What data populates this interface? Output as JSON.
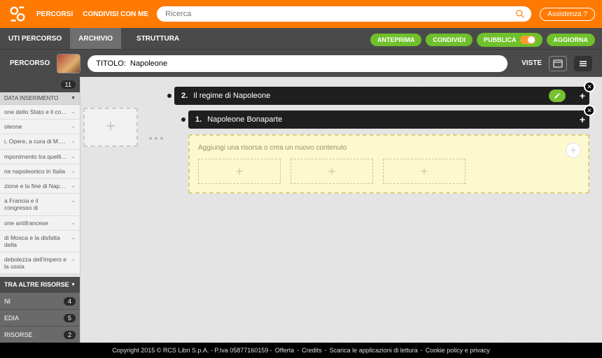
{
  "topbar": {
    "nav": [
      "PERCORSI",
      "CONDIVISI CON ME"
    ],
    "search_placeholder": "Ricerca",
    "assist": "Assistenza ?"
  },
  "subbar": {
    "tab1": "UTI PERCORSO",
    "tab2": "ARCHIVIO",
    "tab3": "STRUTTURA"
  },
  "actions": {
    "anteprima": "ANTEPRIMA",
    "condividi": "CONDIVIDI",
    "pubblica": "PUBBLICA",
    "pubblica_state": "ON",
    "aggiorna": "AGGIORNA"
  },
  "header2": {
    "percorso": "PERCORSO",
    "titolo_prefix": "TITOLO:  ",
    "titolo_value": "Napoleone",
    "viste": "VISTE"
  },
  "sidebar": {
    "count": "11",
    "filter": "DATA INSERIMENTO",
    "items": [
      "one dello Stato e il codice civile",
      "oleone",
      "i, Opere, a cura di M. Martell ...",
      "mponimento tra quelli dedica ...",
      "ne napoleonico in Italia",
      "zione e la fine di Napoleone",
      "a Francia e il congresso di",
      "one antifrancese",
      "di Mosca e la disfatta della",
      "debolezza dell'impero e la ussia"
    ],
    "altra": "TRA ALTRE RISORSE",
    "cats": [
      {
        "label": "NI",
        "count": "4"
      },
      {
        "label": "EDIA",
        "count": "5"
      },
      {
        "label": "RISORSE",
        "count": "2"
      }
    ]
  },
  "canvas": {
    "row1_num": "2.",
    "row1_title": "Il regime di Napoleone",
    "row2_num": "1.",
    "row2_title": "Napoleone Bonaparte",
    "prompt": "Aggiungi una risorsa o crea un nuovo contenuto"
  },
  "footer": {
    "copyright": "Copyright 2015 © RCS Libri S.p.A. - P.Iva 05877160159 -",
    "links": [
      "Offerta",
      "Credits",
      "Scarica le applicazioni di lettura",
      "Cookie policy e privacy"
    ]
  }
}
